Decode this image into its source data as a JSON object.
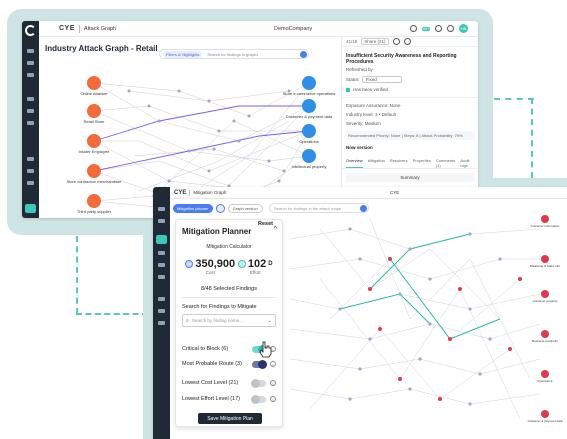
{
  "back_window": {
    "brand": "CYE",
    "section": "Attack Graph",
    "company": "DemoCompany",
    "badge": "99+",
    "avatar": "HB",
    "title": "Industry Attack Graph - Retail",
    "filters_label": "Filters & Highlights",
    "search_placeholder": "Search for findings in graphs",
    "nodes_left": [
      {
        "label": "Online Attacker"
      },
      {
        "label": "Retail Store"
      },
      {
        "label": "Insider Employee"
      },
      {
        "label": "Store contractor/ merchandiser"
      },
      {
        "label": "Third party supplier"
      }
    ],
    "nodes_right": [
      {
        "label": "Store e-commerce operations"
      },
      {
        "label": "Customer & payment data"
      },
      {
        "label": "Operations"
      },
      {
        "label": "Intellectual property"
      }
    ],
    "panel": {
      "pager": "41/18",
      "share": "Share (21)",
      "finding_title": "Insufficient Security Awareness and Reporting Procedures",
      "refreshed_by": "Refreshed by",
      "status_label": "Status",
      "status_value": "Fixed",
      "verified": "Has been verified",
      "exposure": "Exposure Assurance: None",
      "industry": "Industry level: 3 • Default",
      "severity": "Severity: Medium",
      "stats": "Recommended Priority: None | Steps: 8 | Attack Probability: 79%",
      "version": "Now version",
      "tabs": [
        "Overview",
        "Mitigation",
        "Resolvers",
        "Properties",
        "Comments (1)",
        "Audit logs"
      ],
      "summary": "Summary"
    }
  },
  "front_window": {
    "brand": "CYE",
    "section": "Mitigation Graph",
    "company": "CYE",
    "toolbar": {
      "mitigation_planner": "Mitigation planner",
      "graph_version": "Graph version",
      "search_placeholder": "Search for findings in the attack maps"
    },
    "planner": {
      "title": "Mitigation Planner",
      "reset": "Reset",
      "caret": "^",
      "calculator": "Mitigation Calculator",
      "cost_value": "350,900",
      "cost_label": "Cost",
      "effort_value": "102",
      "effort_unit": "D",
      "effort_label": "Effort",
      "selected_findings": "8/48  Selected Findings",
      "search_label": "Search for Findings to Mitigate",
      "search_placeholder": "Search by finding name...",
      "toggles": [
        {
          "label": "Critical to Block (6)",
          "state": "on"
        },
        {
          "label": "Most Probable Route (3)",
          "state": "on"
        },
        {
          "label": "Lowest Cost Level (21)",
          "state": "off"
        },
        {
          "label": "Lowest Effort Level (17)",
          "state": "off"
        }
      ],
      "save_button": "Save Mitigation Plan"
    },
    "right_nodes": [
      {
        "label": "Customer information"
      },
      {
        "label": "Marketing & Sales info"
      },
      {
        "label": "Customer property"
      },
      {
        "label": "Business continuity"
      },
      {
        "label": "Operations"
      },
      {
        "label": "Customer & payment data"
      }
    ]
  },
  "colors": {
    "accent_teal": "#3ec6b8",
    "sidebar": "#1f2a36",
    "orange_node": "#f26b3a",
    "blue_node": "#2f8fe6",
    "red_node": "#e03a4a",
    "link_blue": "#4a7cf3"
  }
}
